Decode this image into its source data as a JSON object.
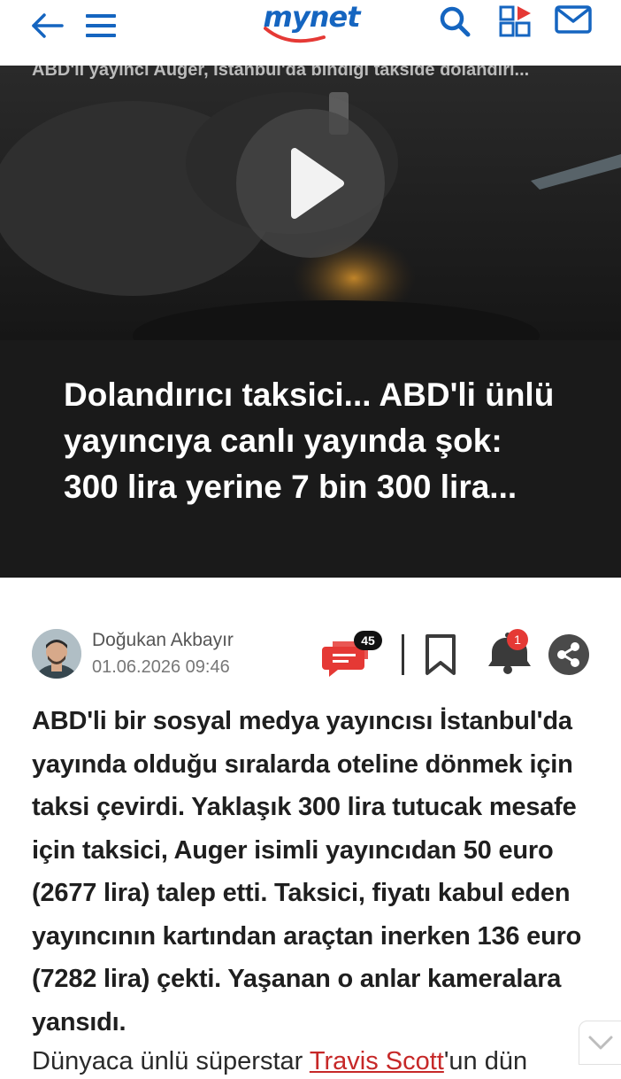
{
  "header": {
    "logo_text": "mynet",
    "brand_color": "#1565c0",
    "accent_color": "#e53935",
    "icons": [
      "back-arrow-icon",
      "hamburger-menu-icon",
      "search-icon",
      "apps-grid-icon",
      "mail-icon"
    ]
  },
  "video": {
    "title": "ABD'li yayıncı Auger, İstanbul'da bindiği takside dolandırı...",
    "play_icon": "play-icon"
  },
  "article": {
    "headline": "Dolandırıcı taksici... ABD'li ünlü yayıncıya canlı yayında şok: 300 lira yerine 7 bin 300 lira...",
    "author": {
      "name": "Doğukan Akbayır",
      "date": "01.06.2026 09:46"
    },
    "actions": {
      "comment_count": "45",
      "notification_count": "1"
    },
    "body": "ABD'li bir sosyal medya yayıncısı İstanbul'da yayında olduğu sıralarda oteline dönmek için taksi çevirdi. Yaklaşık 300 lira tutucak mesafe için taksici, Auger isimli yayıncıdan 50 euro (2677 lira) talep etti. Taksici, fiyatı kabul eden yayıncının kartından araçtan inerken 136 euro (7282 lira) çekti. Yaşanan o anlar kameralara yansıdı.",
    "next_paragraph": {
      "prefix": "Dünyaca ünlü süperstar ",
      "link": "Travis Scott",
      "suffix": "'un dün"
    }
  }
}
